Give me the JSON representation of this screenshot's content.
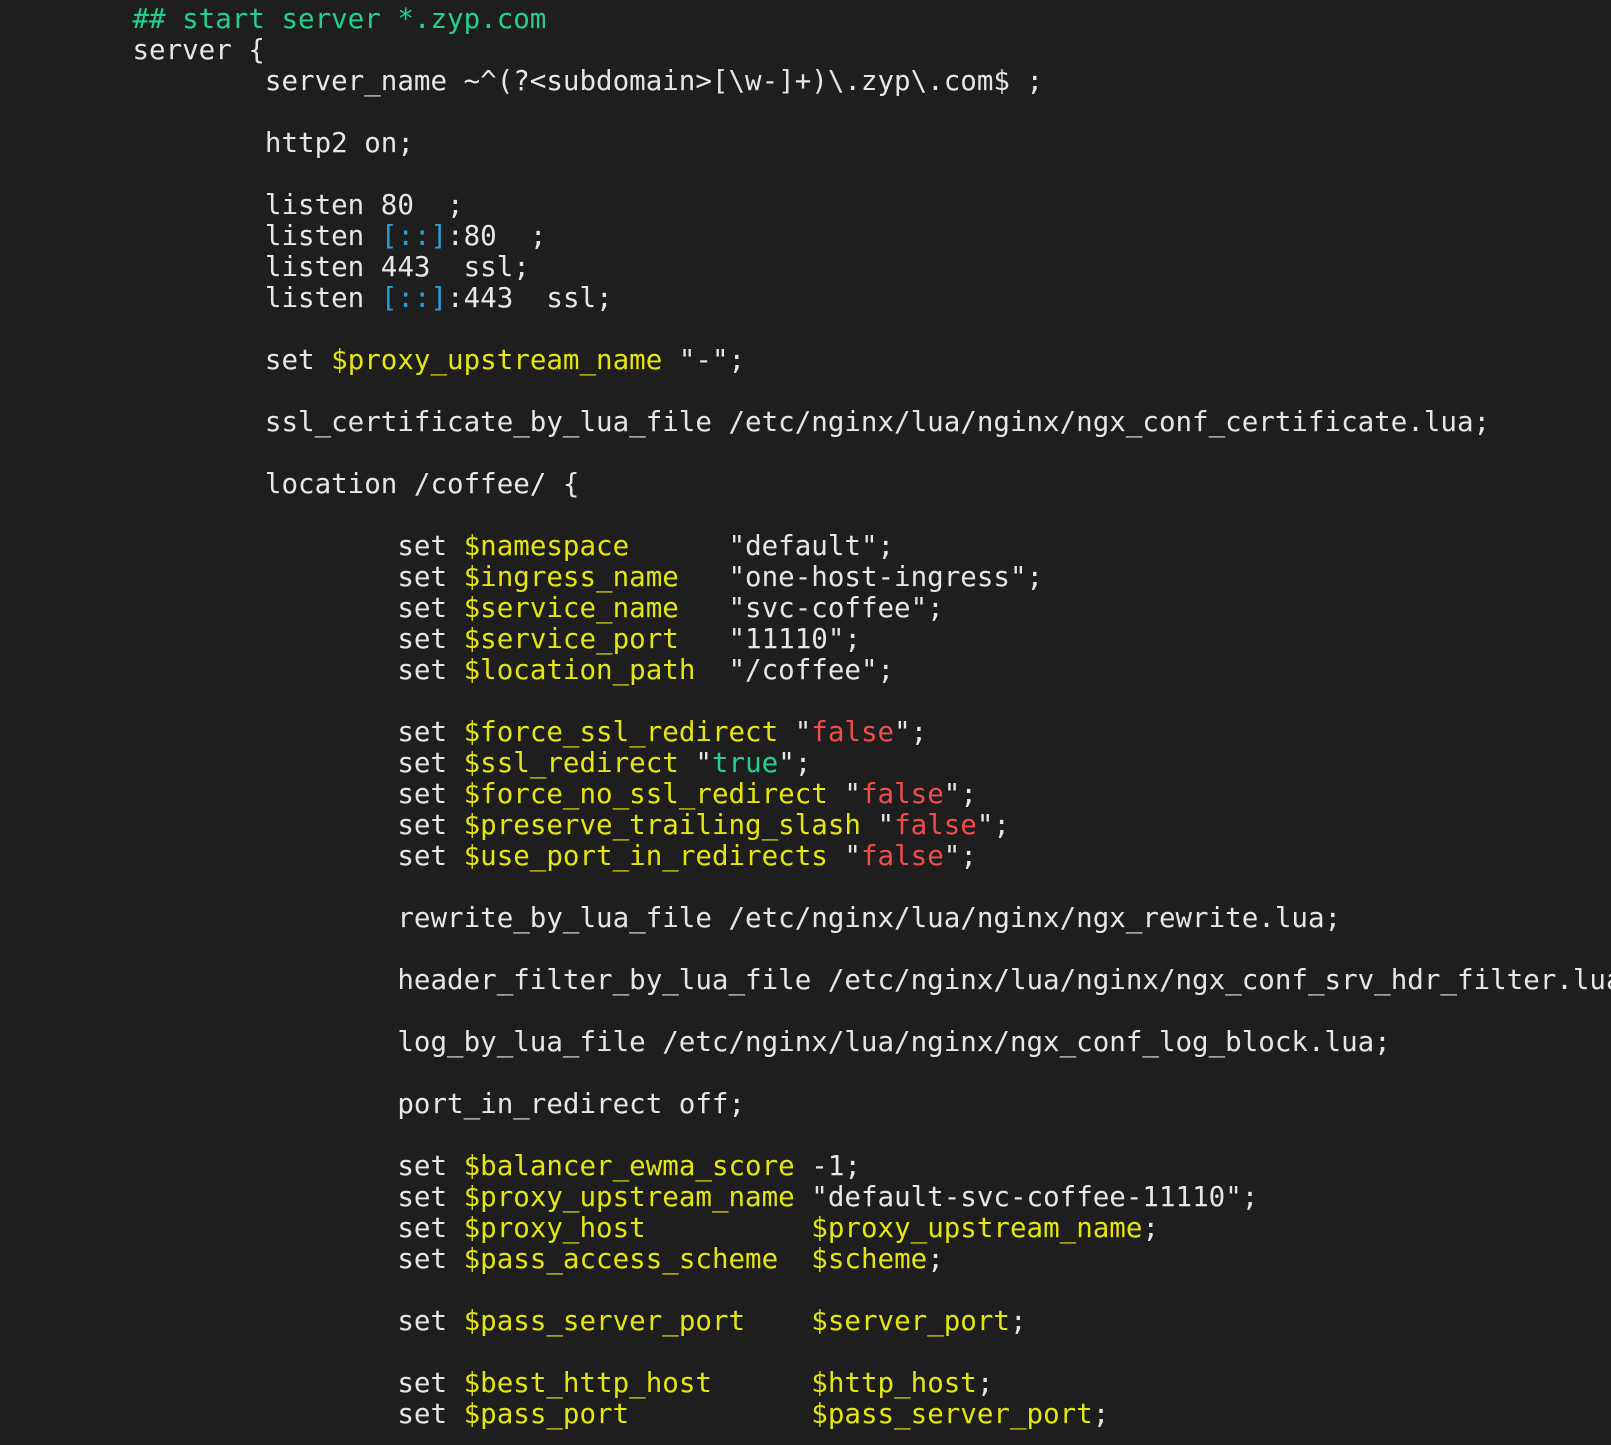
{
  "window": {
    "title": ""
  },
  "colors": {
    "background": "#1e1e1e",
    "plain": "#e6e6e6",
    "comment": "#23d18b",
    "variable": "#e5e510",
    "ipv6": "#2a9fd6",
    "false": "#f14c4c",
    "true": "#23d18b"
  },
  "lines": [
    [
      [
        "comment",
        "        ## start server *.zyp.com"
      ]
    ],
    [
      [
        "plain",
        "        server {"
      ]
    ],
    [
      [
        "plain",
        "                server_name ~^(?<subdomain>[\\w-]+)\\.zyp\\.com$ ;"
      ]
    ],
    [
      [
        "plain",
        ""
      ]
    ],
    [
      [
        "plain",
        "                http2 on;"
      ]
    ],
    [
      [
        "plain",
        ""
      ]
    ],
    [
      [
        "plain",
        "                listen 80  ;"
      ]
    ],
    [
      [
        "plain",
        "                listen "
      ],
      [
        "ipv6",
        "[::]"
      ],
      [
        "plain",
        ":80  ;"
      ]
    ],
    [
      [
        "plain",
        "                listen 443  ssl;"
      ]
    ],
    [
      [
        "plain",
        "                listen "
      ],
      [
        "ipv6",
        "[::]"
      ],
      [
        "plain",
        ":443  ssl;"
      ]
    ],
    [
      [
        "plain",
        ""
      ]
    ],
    [
      [
        "plain",
        "                set "
      ],
      [
        "variable",
        "$proxy_upstream_name"
      ],
      [
        "plain",
        " \"-\";"
      ]
    ],
    [
      [
        "plain",
        ""
      ]
    ],
    [
      [
        "plain",
        "                ssl_certificate_by_lua_file /etc/nginx/lua/nginx/ngx_conf_certificate.lua;"
      ]
    ],
    [
      [
        "plain",
        ""
      ]
    ],
    [
      [
        "plain",
        "                location /coffee/ {"
      ]
    ],
    [
      [
        "plain",
        ""
      ]
    ],
    [
      [
        "plain",
        "                        set "
      ],
      [
        "variable",
        "$namespace"
      ],
      [
        "plain",
        "      \"default\";"
      ]
    ],
    [
      [
        "plain",
        "                        set "
      ],
      [
        "variable",
        "$ingress_name"
      ],
      [
        "plain",
        "   \"one-host-ingress\";"
      ]
    ],
    [
      [
        "plain",
        "                        set "
      ],
      [
        "variable",
        "$service_name"
      ],
      [
        "plain",
        "   \"svc-coffee\";"
      ]
    ],
    [
      [
        "plain",
        "                        set "
      ],
      [
        "variable",
        "$service_port"
      ],
      [
        "plain",
        "   \"11110\";"
      ]
    ],
    [
      [
        "plain",
        "                        set "
      ],
      [
        "variable",
        "$location_path"
      ],
      [
        "plain",
        "  \"/coffee\";"
      ]
    ],
    [
      [
        "plain",
        ""
      ]
    ],
    [
      [
        "plain",
        "                        set "
      ],
      [
        "variable",
        "$force_ssl_redirect"
      ],
      [
        "plain",
        " \""
      ],
      [
        "false",
        "false"
      ],
      [
        "plain",
        "\";"
      ]
    ],
    [
      [
        "plain",
        "                        set "
      ],
      [
        "variable",
        "$ssl_redirect"
      ],
      [
        "plain",
        " \""
      ],
      [
        "true",
        "true"
      ],
      [
        "plain",
        "\";"
      ]
    ],
    [
      [
        "plain",
        "                        set "
      ],
      [
        "variable",
        "$force_no_ssl_redirect"
      ],
      [
        "plain",
        " \""
      ],
      [
        "false",
        "false"
      ],
      [
        "plain",
        "\";"
      ]
    ],
    [
      [
        "plain",
        "                        set "
      ],
      [
        "variable",
        "$preserve_trailing_slash"
      ],
      [
        "plain",
        " \""
      ],
      [
        "false",
        "false"
      ],
      [
        "plain",
        "\";"
      ]
    ],
    [
      [
        "plain",
        "                        set "
      ],
      [
        "variable",
        "$use_port_in_redirects"
      ],
      [
        "plain",
        " \""
      ],
      [
        "false",
        "false"
      ],
      [
        "plain",
        "\";"
      ]
    ],
    [
      [
        "plain",
        ""
      ]
    ],
    [
      [
        "plain",
        "                        rewrite_by_lua_file /etc/nginx/lua/nginx/ngx_rewrite.lua;"
      ]
    ],
    [
      [
        "plain",
        ""
      ]
    ],
    [
      [
        "plain",
        "                        header_filter_by_lua_file /etc/nginx/lua/nginx/ngx_conf_srv_hdr_filter.lua;"
      ]
    ],
    [
      [
        "plain",
        ""
      ]
    ],
    [
      [
        "plain",
        "                        log_by_lua_file /etc/nginx/lua/nginx/ngx_conf_log_block.lua;"
      ]
    ],
    [
      [
        "plain",
        ""
      ]
    ],
    [
      [
        "plain",
        "                        port_in_redirect off;"
      ]
    ],
    [
      [
        "plain",
        ""
      ]
    ],
    [
      [
        "plain",
        "                        set "
      ],
      [
        "variable",
        "$balancer_ewma_score"
      ],
      [
        "plain",
        " -1;"
      ]
    ],
    [
      [
        "plain",
        "                        set "
      ],
      [
        "variable",
        "$proxy_upstream_name"
      ],
      [
        "plain",
        " \"default-svc-coffee-11110\";"
      ]
    ],
    [
      [
        "plain",
        "                        set "
      ],
      [
        "variable",
        "$proxy_host"
      ],
      [
        "plain",
        "          "
      ],
      [
        "variable",
        "$proxy_upstream_name"
      ],
      [
        "plain",
        ";"
      ]
    ],
    [
      [
        "plain",
        "                        set "
      ],
      [
        "variable",
        "$pass_access_scheme"
      ],
      [
        "plain",
        "  "
      ],
      [
        "variable",
        "$scheme"
      ],
      [
        "plain",
        ";"
      ]
    ],
    [
      [
        "plain",
        ""
      ]
    ],
    [
      [
        "plain",
        "                        set "
      ],
      [
        "variable",
        "$pass_server_port"
      ],
      [
        "plain",
        "    "
      ],
      [
        "variable",
        "$server_port"
      ],
      [
        "plain",
        ";"
      ]
    ],
    [
      [
        "plain",
        ""
      ]
    ],
    [
      [
        "plain",
        "                        set "
      ],
      [
        "variable",
        "$best_http_host"
      ],
      [
        "plain",
        "      "
      ],
      [
        "variable",
        "$http_host"
      ],
      [
        "plain",
        ";"
      ]
    ],
    [
      [
        "plain",
        "                        set "
      ],
      [
        "variable",
        "$pass_port"
      ],
      [
        "plain",
        "           "
      ],
      [
        "variable",
        "$pass_server_port"
      ],
      [
        "plain",
        ";"
      ]
    ]
  ]
}
